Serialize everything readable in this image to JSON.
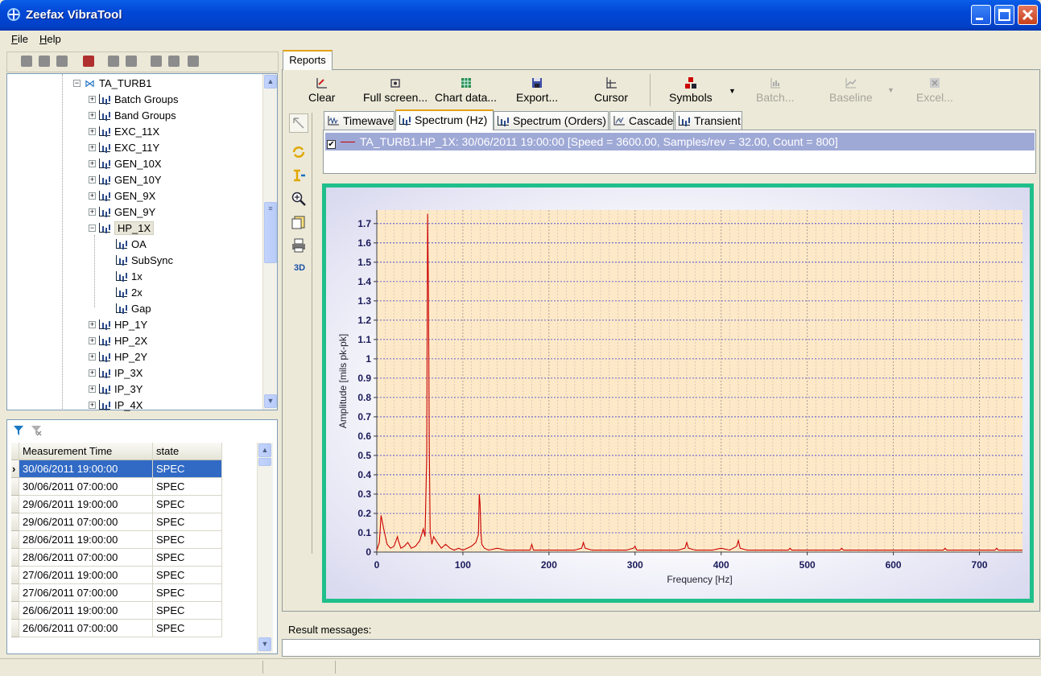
{
  "app": {
    "title": "Zeefax VibraTool"
  },
  "menu": [
    {
      "label": "File",
      "accel": "F",
      "rest": "ile"
    },
    {
      "label": "Help",
      "accel": "H",
      "rest": "elp"
    }
  ],
  "tree": {
    "root": "TA_TURB1",
    "items": [
      {
        "label": "Batch Groups",
        "icon": "batch-groups-icon"
      },
      {
        "label": "Band Groups",
        "icon": "band-groups-icon"
      },
      {
        "label": "EXC_11X"
      },
      {
        "label": "EXC_11Y"
      },
      {
        "label": "GEN_10X"
      },
      {
        "label": "GEN_10Y"
      },
      {
        "label": "GEN_9X"
      },
      {
        "label": "GEN_9Y"
      },
      {
        "label": "HP_1X",
        "expanded": true,
        "children": [
          "OA",
          "SubSync",
          "1x",
          "2x",
          "Gap"
        ]
      },
      {
        "label": "HP_1Y"
      },
      {
        "label": "HP_2X"
      },
      {
        "label": "HP_2Y"
      },
      {
        "label": "IP_3X"
      },
      {
        "label": "IP_3Y"
      },
      {
        "label": "IP_4X"
      }
    ]
  },
  "grid": {
    "headers": [
      "Measurement Time",
      "state"
    ],
    "rows": [
      [
        "30/06/2011 19:00:00",
        "SPEC"
      ],
      [
        "30/06/2011 07:00:00",
        "SPEC"
      ],
      [
        "29/06/2011 19:00:00",
        "SPEC"
      ],
      [
        "29/06/2011 07:00:00",
        "SPEC"
      ],
      [
        "28/06/2011 19:00:00",
        "SPEC"
      ],
      [
        "28/06/2011 07:00:00",
        "SPEC"
      ],
      [
        "27/06/2011 19:00:00",
        "SPEC"
      ],
      [
        "27/06/2011 07:00:00",
        "SPEC"
      ],
      [
        "26/06/2011 19:00:00",
        "SPEC"
      ],
      [
        "26/06/2011 07:00:00",
        "SPEC"
      ]
    ]
  },
  "reports_tab": "Reports",
  "toolbar": {
    "clear": "Clear",
    "fullscreen": "Full screen...",
    "chartdata": "Chart data...",
    "export": "Export...",
    "cursor": "Cursor",
    "symbols": "Symbols",
    "batch": "Batch...",
    "baseline": "Baseline",
    "excel": "Excel..."
  },
  "side_3d": "3D",
  "chart_tabs": [
    "Timewave",
    "Spectrum (Hz)",
    "Spectrum (Orders)",
    "Cascade",
    "Transient"
  ],
  "legend": {
    "entry": "TA_TURB1.HP_1X: 30/06/2011 19:00:00 [Speed = 3600.00, Samples/rev = 32.00, Count = 800]"
  },
  "chart_data": {
    "type": "line",
    "title": "",
    "xlabel": "Frequency [Hz]",
    "ylabel": "Amplitude [mils pk-pk]",
    "xlim": [
      0,
      750
    ],
    "ylim": [
      0,
      1.77
    ],
    "xticks": [
      0,
      100,
      200,
      300,
      400,
      500,
      600,
      700
    ],
    "yticks": [
      0,
      0.1,
      0.2,
      0.3,
      0.4,
      0.5,
      0.6,
      0.7,
      0.8,
      0.9,
      1,
      1.1,
      1.2,
      1.3,
      1.4,
      1.5,
      1.6,
      1.7
    ],
    "series": [
      {
        "color": "#cc0000",
        "x": [
          0,
          3,
          5,
          8,
          12,
          16,
          20,
          24,
          25,
          28,
          32,
          36,
          40,
          45,
          50,
          54,
          56,
          58,
          59,
          60,
          61,
          62,
          64,
          66,
          70,
          75,
          80,
          85,
          90,
          95,
          100,
          105,
          110,
          115,
          118,
          119,
          120,
          121,
          122,
          125,
          130,
          140,
          150,
          160,
          170,
          178,
          180,
          182,
          190,
          200,
          210,
          220,
          230,
          238,
          240,
          242,
          250,
          260,
          270,
          280,
          290,
          298,
          300,
          302,
          310,
          320,
          330,
          340,
          350,
          358,
          360,
          362,
          370,
          380,
          390,
          400,
          410,
          418,
          420,
          422,
          430,
          440,
          450,
          460,
          470,
          478,
          480,
          482,
          500,
          520,
          538,
          540,
          542,
          560,
          580,
          600,
          620,
          640,
          658,
          660,
          662,
          680,
          700,
          718,
          720,
          722,
          740,
          750
        ],
        "y": [
          0.01,
          0.05,
          0.19,
          0.12,
          0.04,
          0.02,
          0.03,
          0.08,
          0.06,
          0.02,
          0.03,
          0.05,
          0.02,
          0.03,
          0.06,
          0.12,
          0.08,
          0.49,
          1.75,
          1.34,
          0.55,
          0.1,
          0.04,
          0.08,
          0.05,
          0.02,
          0.04,
          0.02,
          0.01,
          0.02,
          0.01,
          0.02,
          0.03,
          0.05,
          0.09,
          0.3,
          0.25,
          0.1,
          0.04,
          0.02,
          0.01,
          0.02,
          0.01,
          0.01,
          0.01,
          0.01,
          0.04,
          0.01,
          0.01,
          0.01,
          0.01,
          0.01,
          0.01,
          0.02,
          0.05,
          0.02,
          0.01,
          0.01,
          0.01,
          0.01,
          0.01,
          0.02,
          0.03,
          0.01,
          0.01,
          0.01,
          0.01,
          0.01,
          0.01,
          0.02,
          0.05,
          0.02,
          0.01,
          0.01,
          0.01,
          0.02,
          0.01,
          0.03,
          0.06,
          0.02,
          0.01,
          0.01,
          0.01,
          0.01,
          0.01,
          0.01,
          0.02,
          0.01,
          0.01,
          0.01,
          0.01,
          0.02,
          0.01,
          0.01,
          0.01,
          0.01,
          0.01,
          0.01,
          0.01,
          0.02,
          0.01,
          0.01,
          0.01,
          0.01,
          0.02,
          0.01,
          0.01,
          0.01
        ]
      }
    ]
  },
  "result": {
    "label": "Result messages:"
  },
  "colors": {
    "accent": "#e3a21a",
    "plot_bg": "#fde9c7",
    "grid": "#3a3ad0",
    "frame": "#1fbf8b",
    "series": "#cc0000"
  }
}
